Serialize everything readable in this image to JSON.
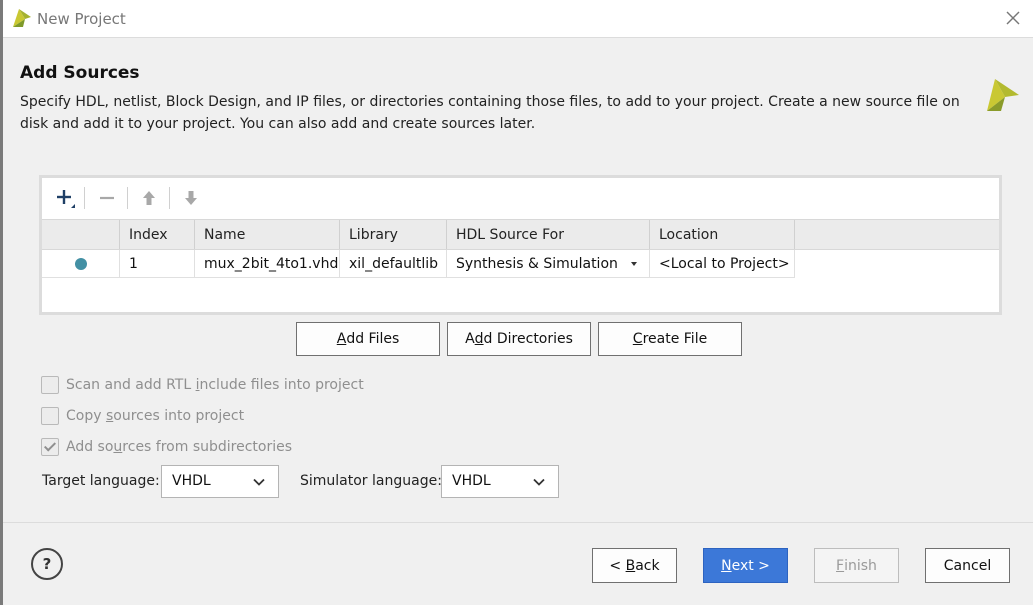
{
  "window": {
    "title": "New Project"
  },
  "header": {
    "title": "Add Sources",
    "description": "Specify HDL, netlist, Block Design, and IP files, or directories containing those files, to add to your project. Create a new source file on disk and add it to your project. You can also add and create sources later."
  },
  "toolbar": {
    "icons": [
      "add-icon",
      "remove-icon",
      "move-up-icon",
      "move-down-icon"
    ]
  },
  "table": {
    "columns": [
      "",
      "Index",
      "Name",
      "Library",
      "HDL Source For",
      "Location"
    ],
    "rows": [
      {
        "status": "status-dot",
        "index": "1",
        "name": "mux_2bit_4to1.vhd",
        "library": "xil_defaultlib",
        "hdl_source_for": "Synthesis & Simulation",
        "location": "<Local to Project>"
      }
    ]
  },
  "actions": {
    "add_files": {
      "pre": "",
      "u": "A",
      "post": "dd Files"
    },
    "add_directories": {
      "pre": "A",
      "u": "d",
      "post": "d Directories"
    },
    "create_file": {
      "pre": "",
      "u": "C",
      "post": "reate File"
    }
  },
  "options": {
    "scan_rtl": {
      "pre": "Scan and add RTL ",
      "u": "i",
      "post": "nclude files into project",
      "checked": false
    },
    "copy_sources": {
      "pre": "Copy ",
      "u": "s",
      "post": "ources into project",
      "checked": false
    },
    "add_subdirs": {
      "pre": "Add so",
      "u": "u",
      "post": "rces from subdirectories",
      "checked": true
    }
  },
  "language": {
    "target_label": "Target language:",
    "target_value": "VHDL",
    "simulator_label": "Simulator language:",
    "simulator_value": "VHDL"
  },
  "footer": {
    "help": "?",
    "back": {
      "pre": "< ",
      "u": "B",
      "post": "ack"
    },
    "next": {
      "pre": "",
      "u": "N",
      "post": "ext >"
    },
    "finish": {
      "pre": "",
      "u": "F",
      "post": "inish"
    },
    "cancel": {
      "pre": "",
      "u": "",
      "post": "Cancel"
    }
  },
  "colors": {
    "accent": "#3c78d8",
    "status_dot": "#4390a4",
    "brand_yellow": "#c9c833",
    "brand_green": "#8a9b2a"
  }
}
